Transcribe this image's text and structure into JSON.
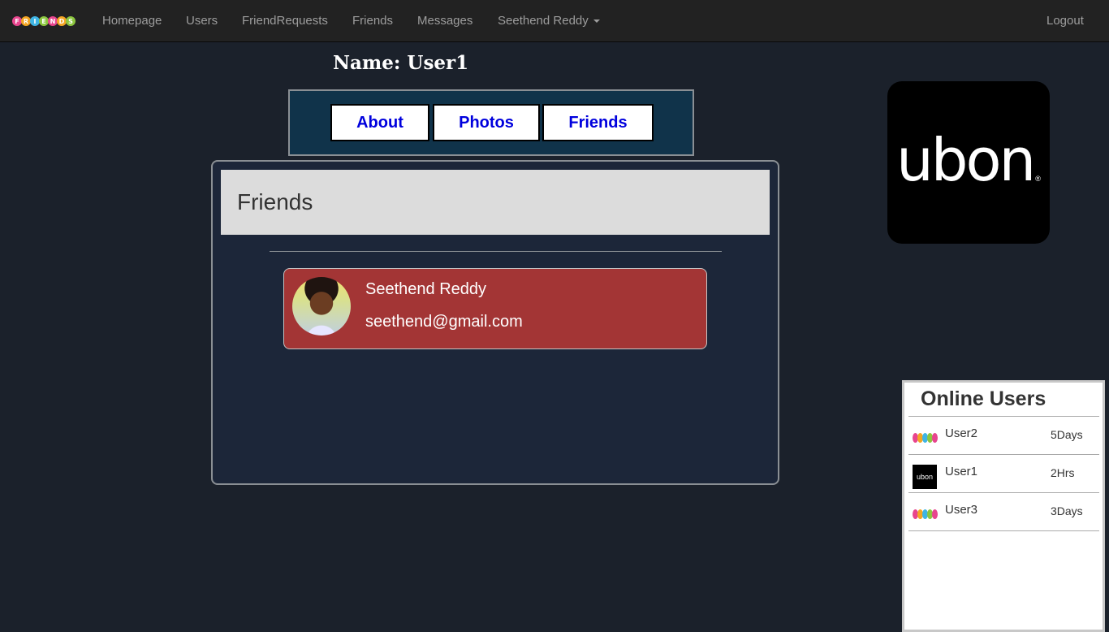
{
  "navbar": {
    "brand_letters": [
      "F",
      "R",
      "I",
      "E",
      "N",
      "D",
      "S"
    ],
    "brand_colors": [
      "#e8458e",
      "#f4a623",
      "#3fb5e5",
      "#8cc63f",
      "#e8458e",
      "#f4a623",
      "#8cc63f"
    ],
    "links": {
      "homepage": "Homepage",
      "users": "Users",
      "friend_requests": "FriendRequests",
      "friends": "Friends",
      "messages": "Messages",
      "user_menu": "Seethend Reddy",
      "logout": "Logout"
    }
  },
  "profile": {
    "name_heading": "Name: User1"
  },
  "tabs": {
    "about": "About",
    "photos": "Photos",
    "friends": "Friends"
  },
  "friends_panel": {
    "title": "Friends",
    "friends": [
      {
        "name": "Seethend Reddy",
        "email": "seethend@gmail.com"
      }
    ]
  },
  "side_logo": {
    "text": "ubon",
    "mark": "®"
  },
  "online_users": {
    "title": "Online Users",
    "users": [
      {
        "name": "User2",
        "time": "5Days",
        "icon": "friends-logo-icon"
      },
      {
        "name": "User1",
        "time": "2Hrs",
        "icon": "ubon-logo-icon"
      },
      {
        "name": "User3",
        "time": "3Days",
        "icon": "friends-logo-icon"
      }
    ],
    "mini_ubon_text": "ubon"
  },
  "colors": {
    "background": "#1b212b",
    "navbar": "#222222",
    "tab_bar": "#10334a",
    "tab_text": "#0000dd",
    "friend_card": "#a33535"
  }
}
